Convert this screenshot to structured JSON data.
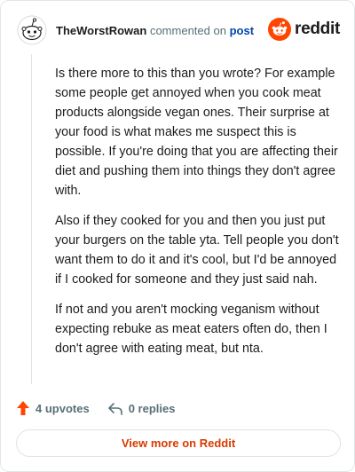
{
  "comment": {
    "username": "TheWorstRowan",
    "action_text": "commented on",
    "post_link": "post",
    "paragraphs": [
      "Is there more to this than you wrote? For example some people get annoyed when you cook meat products alongside vegan ones. Their surprise at your food is what makes me suspect this is possible. If you're doing that you are affecting their diet and pushing them into things they don't agree with.",
      "Also if they cooked for you and then you just put your burgers on the table yta. Tell people you don't want them to do it and it's cool, but I'd be annoyed if I cooked for someone and they just said nah.",
      "If not and you aren't mocking veganism without expecting rebuke as meat eaters often do, then I don't agree with eating meat, but nta."
    ]
  },
  "brand": {
    "wordmark": "reddit",
    "color": "#ff4500"
  },
  "actions": {
    "upvotes": "4 upvotes",
    "replies": "0 replies"
  },
  "footer": {
    "view_more": "View more on Reddit"
  },
  "colors": {
    "upvote_arrow": "#ff4500",
    "link": "#0045ac",
    "view_more_text": "#d93a00",
    "muted": "#576f76"
  },
  "icons": {
    "avatar": "snoo-avatar-icon",
    "brand": "reddit-logo-icon",
    "upvote": "upvote-arrow-icon",
    "reply": "reply-arrow-icon"
  }
}
